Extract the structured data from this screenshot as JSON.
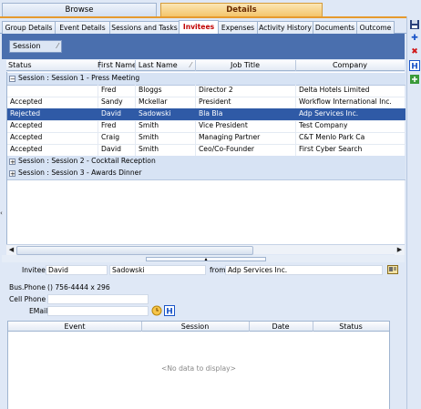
{
  "top_tabs": {
    "browse": "Browse",
    "details": "Details"
  },
  "sub_tabs": [
    "Group Details",
    "Event Details",
    "Sessions and Tasks",
    "Invitees",
    "Expenses",
    "Activity History",
    "Documents",
    "Outcome"
  ],
  "group_by": {
    "label": "Session"
  },
  "grid": {
    "columns": [
      "Status",
      "First Name",
      "Last Name",
      "Job Title",
      "Company"
    ],
    "groups": [
      {
        "label": "Session : Session 1 - Press Meeting",
        "expanded": true,
        "rows": [
          {
            "status": "",
            "first": "Fred",
            "last": "Bloggs",
            "title": "Director 2",
            "company": "Delta Hotels Limited"
          },
          {
            "status": "Accepted",
            "first": "Sandy",
            "last": "Mckellar",
            "title": "President",
            "company": "Workflow International Inc."
          },
          {
            "status": "Rejected",
            "first": "David",
            "last": "Sadowski",
            "title": "Bla Bla",
            "company": "Adp Services Inc."
          },
          {
            "status": "Accepted",
            "first": "Fred",
            "last": "Smith",
            "title": "Vice President",
            "company": "Test Company"
          },
          {
            "status": "Accepted",
            "first": "Craig",
            "last": "Smith",
            "title": "Managing Partner",
            "company": "C&T Menlo Park Ca"
          },
          {
            "status": "Accepted",
            "first": "David",
            "last": "Smith",
            "title": "Ceo/Co-Founder",
            "company": "First Cyber Search"
          }
        ]
      },
      {
        "label": "Session : Session 2 - Cocktail Reception",
        "expanded": false,
        "rows": []
      },
      {
        "label": "Session : Session 3 - Awards Dinner",
        "expanded": false,
        "rows": []
      }
    ],
    "selected_row": 2
  },
  "invitee": {
    "label": "Invitee",
    "first": "David",
    "last": "Sadowski",
    "from_label": "from",
    "company": "Adp Services Inc.",
    "bus_phone_label": "Bus.Phone",
    "bus_phone": "() 756-4444 x 296",
    "cell_label": "Cell Phone",
    "cell": "",
    "email_label": "EMail",
    "email": ""
  },
  "bottom_grid": {
    "columns": [
      "Event",
      "Session",
      "Date",
      "Status"
    ],
    "empty_text": "<No data to display>"
  },
  "colors": {
    "accent": "#e69a2e",
    "selection": "#2f5aa6",
    "panel": "#4a6fae"
  }
}
